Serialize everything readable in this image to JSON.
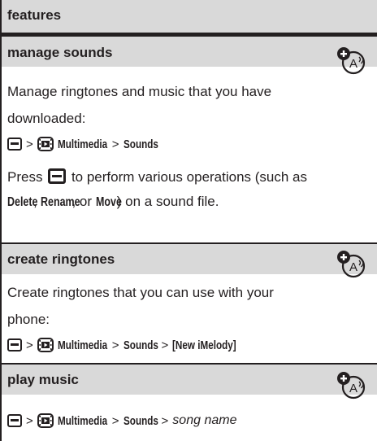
{
  "header": {
    "title": "features"
  },
  "sections": [
    {
      "title": "manage sounds",
      "icon": "network-dependent-feature-icon",
      "desc": "Manage ringtones and music that you have downloaded:",
      "path": {
        "menu": "Multimedia",
        "sep": ">",
        "item": "Sounds"
      },
      "press_before": "Press",
      "press_after": "to perform various operations (such as",
      "press_line2": {
        "op1": "Delete",
        "comma1": ",",
        "op2": "Rename",
        "or": ", or",
        "op3": "Move",
        "tail": ") on a sound file."
      }
    },
    {
      "title": "create ringtones",
      "icon": "network-dependent-feature-icon",
      "desc": "Create ringtones that you can use with your phone:",
      "path": {
        "menu": "Multimedia",
        "sep": ">",
        "item": "Sounds",
        "item2": "[New iMelody]"
      }
    },
    {
      "title": "play music",
      "icon": "network-dependent-feature-icon",
      "path": {
        "menu": "Multimedia",
        "sep": ">",
        "item": "Sounds",
        "item2": "song name"
      }
    }
  ]
}
